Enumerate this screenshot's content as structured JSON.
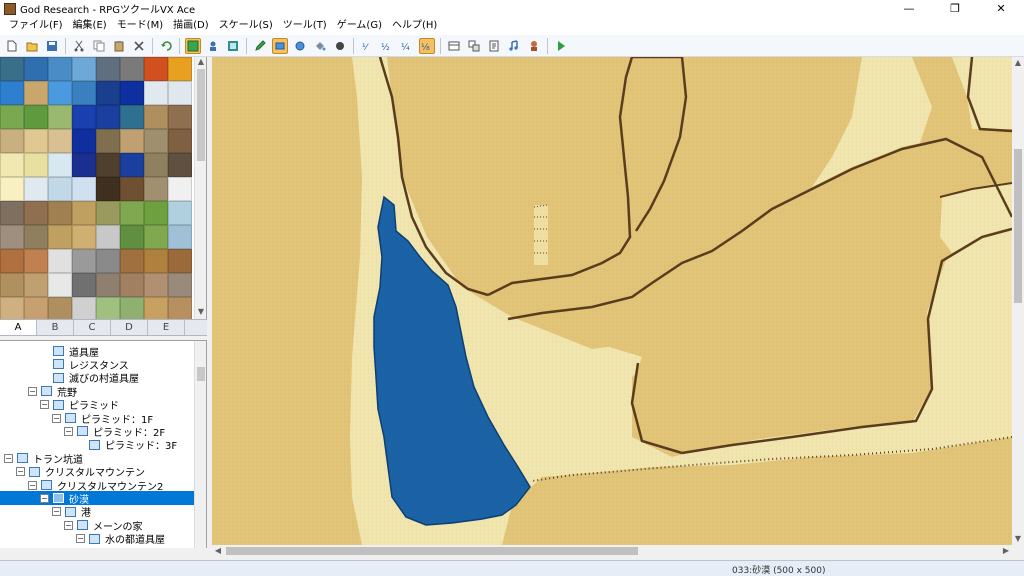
{
  "window": {
    "title": "God Research - RPGツクールVX Ace",
    "minimize": "—",
    "maximize": "❐",
    "close": "✕"
  },
  "menu": [
    "ファイル(F)",
    "編集(E)",
    "モード(M)",
    "描画(D)",
    "スケール(S)",
    "ツール(T)",
    "ゲーム(G)",
    "ヘルプ(H)"
  ],
  "toolbar": {
    "buttons": [
      "new-project",
      "open-project",
      "save-project",
      "cut",
      "copy",
      "paste",
      "delete",
      "undo",
      "map-mode",
      "event-mode",
      "region-mode",
      "pencil",
      "rectangle",
      "ellipse",
      "fill",
      "shadow-pen",
      "scale-1-1",
      "scale-1-2",
      "scale-1-4",
      "scale-1-8",
      "database",
      "resource-manager",
      "script-editor",
      "sound-test",
      "character-generator",
      "playtest"
    ]
  },
  "tileset_tabs": [
    "A",
    "B",
    "C",
    "D",
    "E"
  ],
  "selected_tab": "A",
  "map_tree": [
    {
      "label": "道具屋",
      "depth": 3,
      "expander": ""
    },
    {
      "label": "レジスタンス",
      "depth": 3,
      "expander": ""
    },
    {
      "label": "滅びの村道具屋",
      "depth": 3,
      "expander": ""
    },
    {
      "label": "荒野",
      "depth": 2,
      "expander": "−"
    },
    {
      "label": "ピラミッド",
      "depth": 3,
      "expander": "−"
    },
    {
      "label": "ピラミッド：1F",
      "depth": 4,
      "expander": "−"
    },
    {
      "label": "ピラミッド：2F",
      "depth": 5,
      "expander": "−"
    },
    {
      "label": "ピラミッド：3F",
      "depth": 6,
      "expander": ""
    },
    {
      "label": "トラン坑道",
      "depth": 0,
      "expander": "−"
    },
    {
      "label": "クリスタルマウンテン",
      "depth": 1,
      "expander": "−"
    },
    {
      "label": "クリスタルマウンテン2",
      "depth": 2,
      "expander": "−"
    },
    {
      "label": "砂漠",
      "depth": 3,
      "expander": "−",
      "selected": true
    },
    {
      "label": "港",
      "depth": 4,
      "expander": "−"
    },
    {
      "label": "メーンの家",
      "depth": 5,
      "expander": "−"
    },
    {
      "label": "水の都道具屋",
      "depth": 6,
      "expander": "−"
    }
  ],
  "status": {
    "map_info": "033:砂漠 (500 x 500)"
  },
  "colors": {
    "sand": "#e2c578",
    "shore": "#f1e6ae",
    "water": "#1b63a6",
    "ridge": "#5a3d1d",
    "selection": "#0078d7"
  }
}
